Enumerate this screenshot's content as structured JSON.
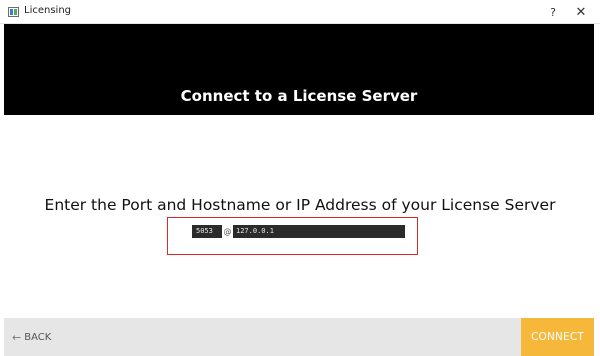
{
  "window": {
    "title": "Licensing",
    "help_label": "?",
    "close_label": "✕"
  },
  "banner": {
    "title": "Connect to a License Server"
  },
  "main": {
    "prompt": "Enter the Port and Hostname or IP Address of your License Server",
    "port_value": "5053",
    "separator": "@",
    "host_value": "127.0.0.1"
  },
  "footer": {
    "back_arrow": "←",
    "back_label": "BACK",
    "connect_label": "CONNECT"
  },
  "colors": {
    "banner_bg": "#000000",
    "accent": "#f5b83a",
    "highlight": "#e02a2a",
    "field_bg": "#2b2b2b",
    "footer_bg": "#e6e6e6"
  },
  "icons": {
    "app": "app-icon",
    "back": "arrow-left-icon"
  }
}
